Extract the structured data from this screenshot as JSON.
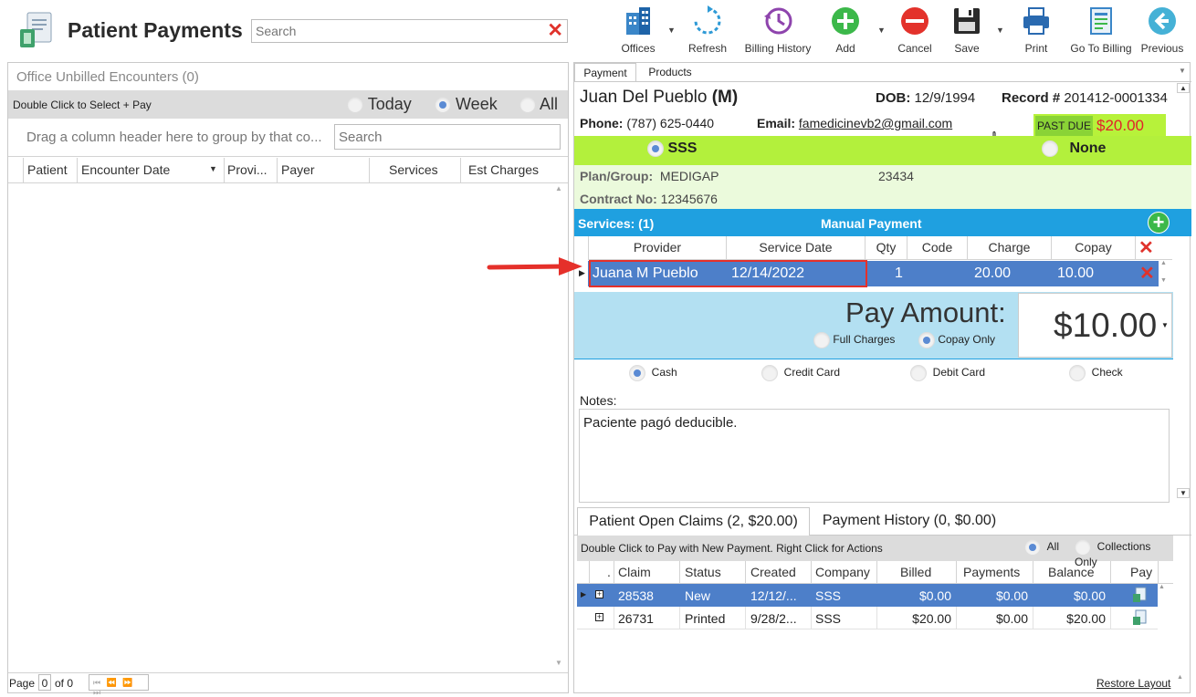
{
  "app": {
    "title": "Patient Payments",
    "search_placeholder": "Search"
  },
  "toolbar": {
    "offices": "Offices",
    "refresh": "Refresh",
    "billing_history": "Billing History",
    "add": "Add",
    "cancel": "Cancel",
    "save": "Save",
    "print": "Print",
    "go_to_billing": "Go To Billing",
    "previous": "Previous"
  },
  "left": {
    "panel_title": "Office Unbilled Encounters (0)",
    "hint": "Double Click to Select + Pay",
    "filters": [
      "Today",
      "Week",
      "All"
    ],
    "selected_filter": "Week",
    "group_hint": "Drag a column header here to group by that co...",
    "search_placeholder": "Search",
    "columns": [
      "Patient",
      "Encounter Date",
      "Provi...",
      "Payer",
      "Services",
      "Est Charges"
    ],
    "pager": {
      "page_label": "Page",
      "page": "0",
      "of_label": "of 0"
    }
  },
  "tabs": [
    "Payment",
    "Products"
  ],
  "patient": {
    "name": "Juan Del Pueblo",
    "sex": "(M)",
    "dob_label": "DOB:",
    "dob": "12/9/1994",
    "record_label": "Record #",
    "record": "201412-0001334",
    "phone_label": "Phone:",
    "phone": "(787) 625-0440",
    "email_label": "Email:",
    "email": "famedicinevb2@gmail.com",
    "past_due_label": "PAST DUE",
    "past_due_amount": "$20.00"
  },
  "insurance": {
    "option_sss": "SSS",
    "option_none": "None",
    "plan_label": "Plan/Group:",
    "plan": "MEDIGAP",
    "group": "23434",
    "contract_label": "Contract No:",
    "contract": "12345676"
  },
  "services": {
    "title": "Services: (1)",
    "mode": "Manual Payment",
    "columns": [
      "Provider",
      "Service Date",
      "Qty",
      "Code",
      "Charge",
      "Copay"
    ],
    "row": {
      "provider": "Juana M Pueblo",
      "date": "12/14/2022",
      "qty": "1",
      "code": "",
      "charge": "20.00",
      "copay": "10.00"
    }
  },
  "pay": {
    "label": "Pay Amount:",
    "amount": "$10.00",
    "full_charges": "Full Charges",
    "copay_only": "Copay Only",
    "methods": [
      "Cash",
      "Credit Card",
      "Debit Card",
      "Check"
    ],
    "selected_method": "Cash"
  },
  "notes": {
    "label": "Notes:",
    "text": "Paciente pagó deducible."
  },
  "claims": {
    "tab_open": "Patient Open Claims (2, $20.00)",
    "tab_history": "Payment History (0, $0.00)",
    "hint": "Double Click to Pay with New Payment. Right Click for Actions",
    "filter_all": "All",
    "filter_collections": "Collections Only",
    "columns": [
      ".",
      "Claim",
      "Status",
      "Created",
      "Company",
      "Billed",
      "Payments",
      "Balance",
      "Pay"
    ],
    "rows": [
      {
        "claim": "28538",
        "status": "New",
        "created": "12/12/...",
        "company": "SSS",
        "billed": "$0.00",
        "payments": "$0.00",
        "balance": "$0.00"
      },
      {
        "claim": "26731",
        "status": "Printed",
        "created": "9/28/2...",
        "company": "SSS",
        "billed": "$20.00",
        "payments": "$0.00",
        "balance": "$20.00"
      }
    ],
    "restore_layout": "Restore Layout"
  }
}
